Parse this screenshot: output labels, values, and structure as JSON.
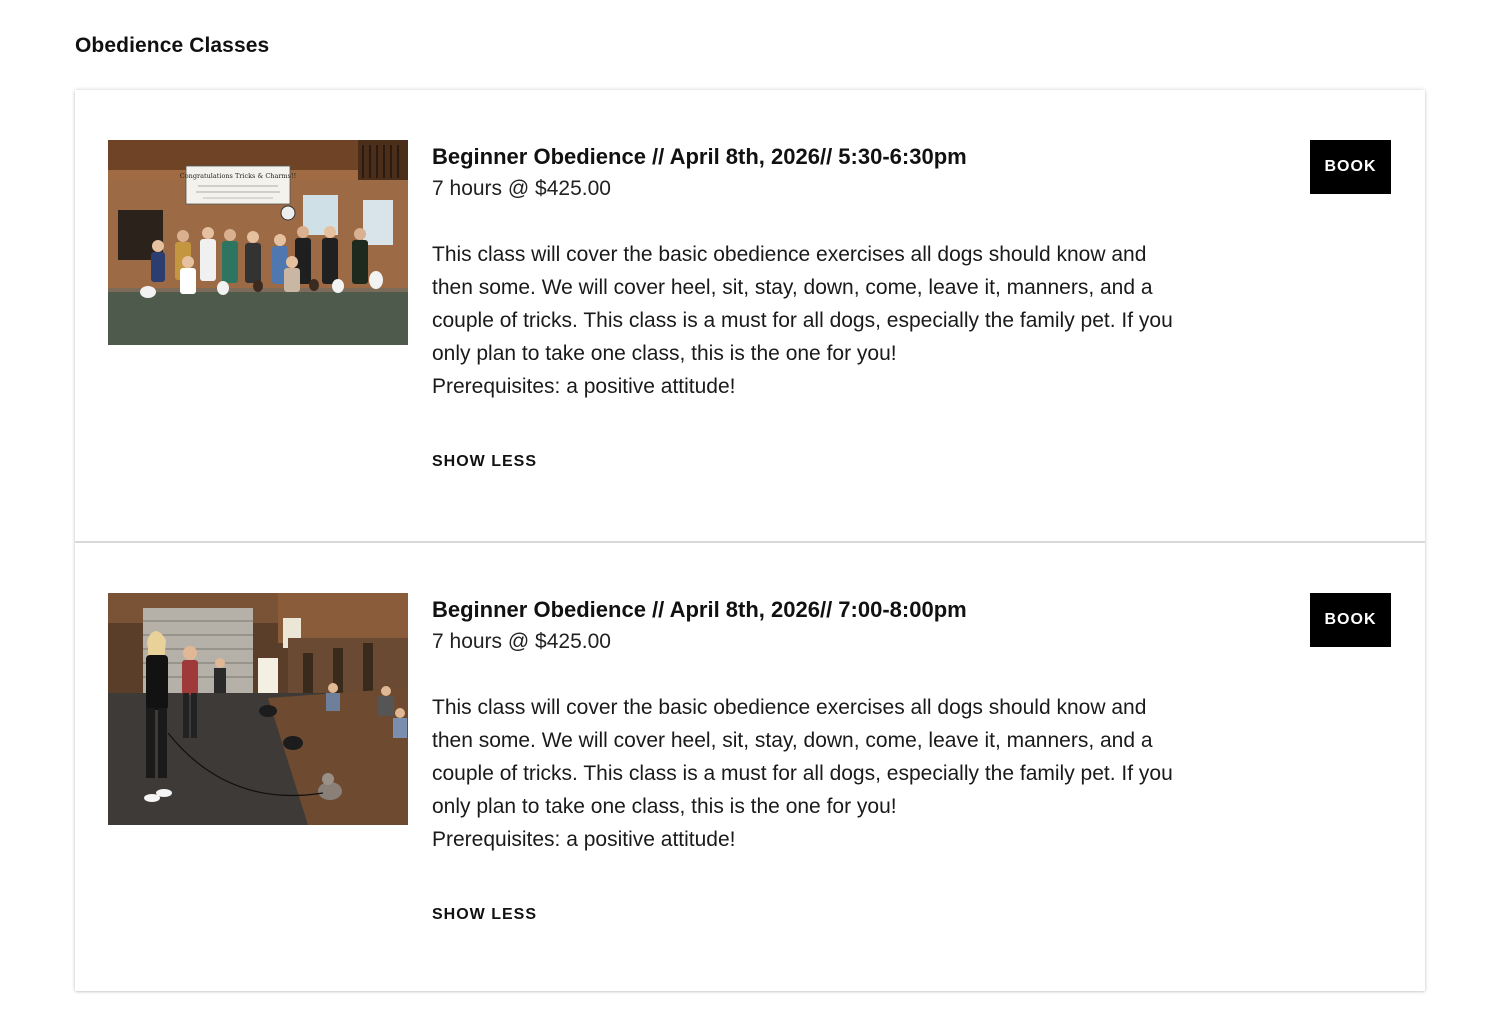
{
  "page": {
    "title": "Obedience Classes"
  },
  "classes": [
    {
      "title": "Beginner Obedience // April 8th, 2026// 5:30-6:30pm",
      "meta": "7 hours @ $425.00",
      "description": [
        "This class will cover the basic obedience exercises all dogs should know and then some. We will cover heel, sit, stay, down, come, leave it, manners, and a couple of tricks. This class is a must for all dogs, especially the family pet. If you only plan to take one class, this is the one for you!",
        "Prerequisites: a positive attitude!"
      ],
      "toggle_label": "SHOW LESS",
      "book_label": "BOOK",
      "photo": {
        "banner_text": "Congratulations Tricks & Charms!!"
      }
    },
    {
      "title": "Beginner Obedience // April 8th, 2026// 7:00-8:00pm",
      "meta": "7 hours @ $425.00",
      "description": [
        "This class will cover the basic obedience exercises all dogs should know and then some. We will cover heel, sit, stay, down, come, leave it, manners, and a couple of tricks. This class is a must for all dogs, especially the family pet. If you only plan to take one class, this is the one for you!",
        "Prerequisites: a positive attitude!"
      ],
      "toggle_label": "SHOW LESS",
      "book_label": "BOOK"
    }
  ],
  "colors": {
    "button_bg": "#000000",
    "button_text": "#ffffff",
    "divider": "#d9d9d9"
  }
}
